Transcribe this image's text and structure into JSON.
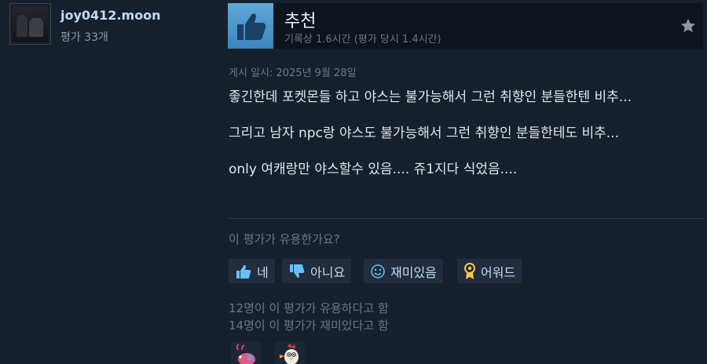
{
  "author": {
    "name": "joy0412.moon",
    "reviews_text": "평가 33개"
  },
  "review": {
    "recommendation": "추천",
    "playtime": "기록상 1.6시간 (평가 당시 1.4시간)",
    "posted_date": "게시 일시: 2025년 9월 28일",
    "paragraphs": [
      "좋긴한데 포켓몬들 하고 야스는 불가능해서 그런 취향인 분들한텐 비추...",
      "그리고 남자 npc랑 야스도 불가능해서 그런 취향인 분들한테도 비추...",
      "only 여캐랑만 야스할수 있음.... 쥬1지다 식었음...."
    ]
  },
  "feedback": {
    "question": "이 평가가 유용한가요?",
    "buttons": {
      "yes": "네",
      "no": "아니요",
      "funny": "재미있음",
      "award": "어워드"
    },
    "helpful_count": "12명이 이 평가가 유용하다고 함",
    "funny_count": "14명이 이 평가가 재미있다고 함"
  },
  "awards": [
    {
      "icon": "pink-creature-award-icon"
    },
    {
      "icon": "chicken-award-icon"
    }
  ],
  "colors": {
    "background": "#16202d",
    "header": "#0d141d",
    "thumb": "#4a97cc",
    "button": "#212d3d",
    "link": "#c1dbf4",
    "muted": "#697888"
  }
}
